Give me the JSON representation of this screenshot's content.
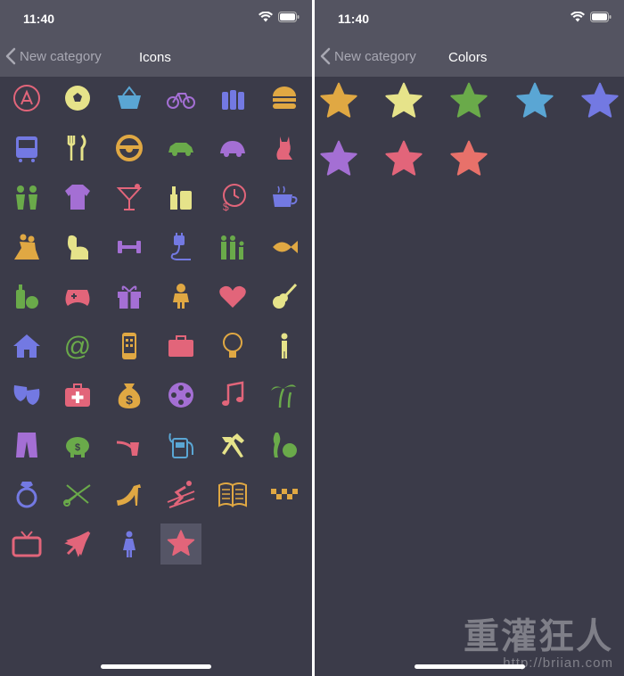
{
  "left": {
    "time": "11:40",
    "back_label": "New category",
    "title": "Icons",
    "icons": [
      {
        "name": "app-store-icon",
        "color": "#e2657a"
      },
      {
        "name": "soccer-ball-icon",
        "color": "#e6e38a"
      },
      {
        "name": "shopping-basket-icon",
        "color": "#5aa6d4"
      },
      {
        "name": "bicycle-icon",
        "color": "#a46fd4"
      },
      {
        "name": "bottles-icon",
        "color": "#7379e2"
      },
      {
        "name": "burger-icon",
        "color": "#e0a843"
      },
      {
        "name": "bus-icon",
        "color": "#7379e2"
      },
      {
        "name": "fork-knife-icon",
        "color": "#e6e38a"
      },
      {
        "name": "steering-wheel-icon",
        "color": "#e0a843"
      },
      {
        "name": "car-icon",
        "color": "#6aaa4a"
      },
      {
        "name": "beetle-car-icon",
        "color": "#a46fd4"
      },
      {
        "name": "cat-icon",
        "color": "#e2657a"
      },
      {
        "name": "children-icon",
        "color": "#6aaa4a"
      },
      {
        "name": "shirt-icon",
        "color": "#a46fd4"
      },
      {
        "name": "cocktail-icon",
        "color": "#e2657a"
      },
      {
        "name": "cosmetics-icon",
        "color": "#e6e38a"
      },
      {
        "name": "clock-money-icon",
        "color": "#e2657a"
      },
      {
        "name": "coffee-cup-icon",
        "color": "#7379e2"
      },
      {
        "name": "dancers-icon",
        "color": "#e0a843"
      },
      {
        "name": "dog-icon",
        "color": "#e6e38a"
      },
      {
        "name": "dumbbell-icon",
        "color": "#a46fd4"
      },
      {
        "name": "plug-icon",
        "color": "#7379e2"
      },
      {
        "name": "family-icon",
        "color": "#6aaa4a"
      },
      {
        "name": "fish-icon",
        "color": "#e0a843"
      },
      {
        "name": "groceries-icon",
        "color": "#6aaa4a"
      },
      {
        "name": "gamepad-icon",
        "color": "#e2657a"
      },
      {
        "name": "gift-icon",
        "color": "#a46fd4"
      },
      {
        "name": "girl-icon",
        "color": "#e0a843"
      },
      {
        "name": "heart-icon",
        "color": "#e2657a"
      },
      {
        "name": "guitar-icon",
        "color": "#e6e38a"
      },
      {
        "name": "house-icon",
        "color": "#7379e2"
      },
      {
        "name": "at-sign-icon",
        "color": "#6aaa4a"
      },
      {
        "name": "phone-icon",
        "color": "#e0a843"
      },
      {
        "name": "briefcase-icon",
        "color": "#e2657a"
      },
      {
        "name": "light-bulb-icon",
        "color": "#e0a843"
      },
      {
        "name": "person-icon",
        "color": "#e6e38a"
      },
      {
        "name": "theater-masks-icon",
        "color": "#7379e2"
      },
      {
        "name": "first-aid-kit-icon",
        "color": "#e2657a"
      },
      {
        "name": "money-bag-icon",
        "color": "#e0a843"
      },
      {
        "name": "film-reel-icon",
        "color": "#a46fd4"
      },
      {
        "name": "music-note-icon",
        "color": "#e2657a"
      },
      {
        "name": "palm-trees-icon",
        "color": "#6aaa4a"
      },
      {
        "name": "pants-icon",
        "color": "#a46fd4"
      },
      {
        "name": "piggy-bank-icon",
        "color": "#6aaa4a"
      },
      {
        "name": "pipe-icon",
        "color": "#e2657a"
      },
      {
        "name": "gas-pump-icon",
        "color": "#5aa6d4"
      },
      {
        "name": "tools-icon",
        "color": "#e6e38a"
      },
      {
        "name": "bowling-icon",
        "color": "#6aaa4a"
      },
      {
        "name": "ring-icon",
        "color": "#7379e2"
      },
      {
        "name": "scissors-comb-icon",
        "color": "#6aaa4a"
      },
      {
        "name": "high-heel-icon",
        "color": "#e0a843"
      },
      {
        "name": "skier-icon",
        "color": "#e2657a"
      },
      {
        "name": "book-icon",
        "color": "#e0a843"
      },
      {
        "name": "taxi-checker-icon",
        "color": "#e0a843"
      },
      {
        "name": "tv-icon",
        "color": "#e2657a"
      },
      {
        "name": "airplane-icon",
        "color": "#e2657a"
      },
      {
        "name": "woman-icon",
        "color": "#7379e2"
      },
      {
        "name": "star-icon",
        "color": "#e2657a",
        "selected": true
      }
    ]
  },
  "right": {
    "time": "11:40",
    "back_label": "New category",
    "title": "Colors",
    "colors": [
      "#e0a843",
      "#e6e38a",
      "#6aaa4a",
      "#5aa6d4",
      "#7379e2",
      "#a46fd4",
      "#e2657a",
      "#e8716a"
    ]
  },
  "watermark": {
    "cn": "重灌狂人",
    "url": "http://briian.com"
  }
}
